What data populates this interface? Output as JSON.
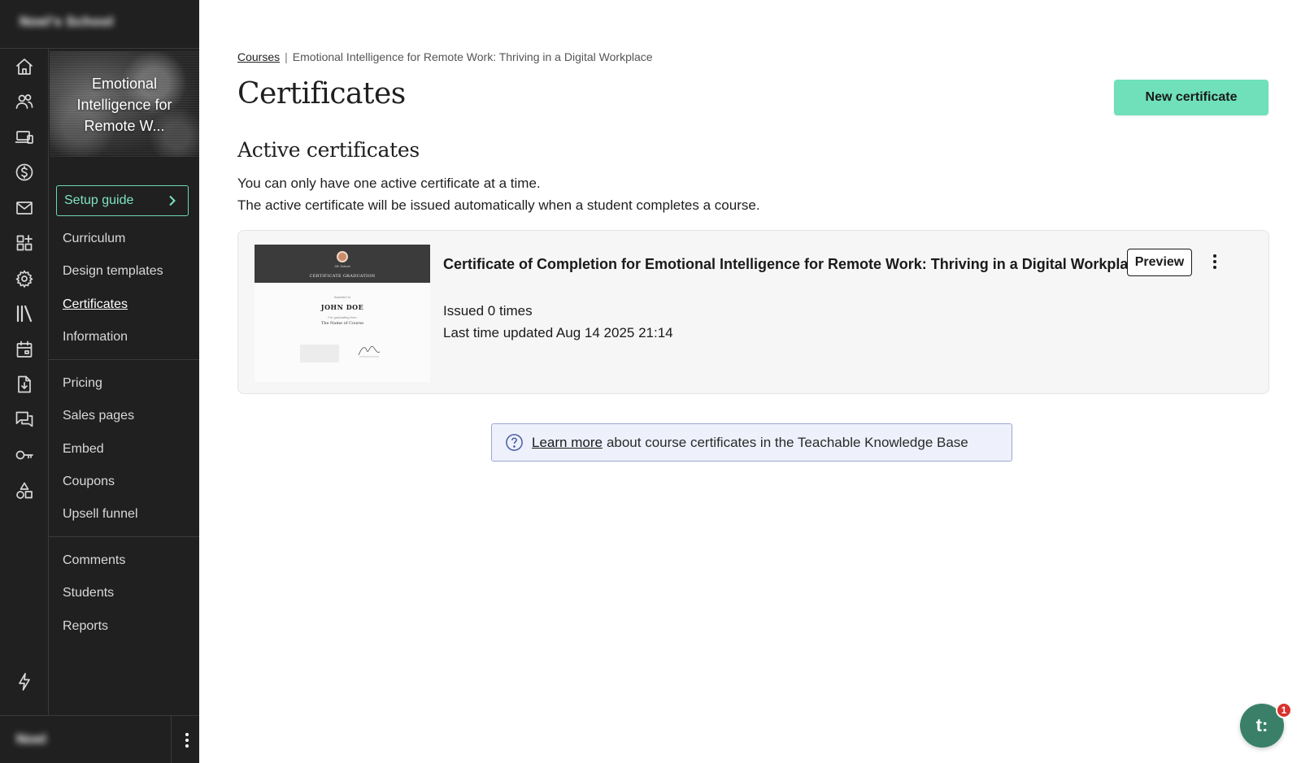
{
  "sidebar": {
    "school_name": "Noel's School",
    "user_name": "Noel",
    "nav_icons": [
      "home-icon",
      "users-icon",
      "devices-icon",
      "dollar-icon",
      "mail-icon",
      "apps-icon",
      "gear-icon",
      "library-icon",
      "calendar-icon",
      "download-icon",
      "chat-icon",
      "key-icon",
      "shapes-icon",
      "lightning-icon"
    ],
    "course": {
      "thumbnail_title": "Emotional Intelligence for Remote W...",
      "setup_guide_label": "Setup guide",
      "groups": [
        [
          "Curriculum",
          "Design templates",
          "Certificates",
          "Information"
        ],
        [
          "Pricing",
          "Sales pages",
          "Embed",
          "Coupons",
          "Upsell funnel"
        ],
        [
          "Comments",
          "Students",
          "Reports"
        ]
      ],
      "active_item": "Certificates"
    }
  },
  "breadcrumb": {
    "root": "Courses",
    "separator": "|",
    "current": "Emotional Intelligence for Remote Work: Thriving in a Digital Workplace"
  },
  "page": {
    "title": "Certificates",
    "new_button": "New certificate",
    "section_title": "Active certificates",
    "desc_line1": "You can only have one active certificate at a time.",
    "desc_line2": "The active certificate will be issued automatically when a student completes a course."
  },
  "certificate": {
    "title": "Certificate of Completion for Emotional Intelligence for Remote Work: Thriving in a Digital Workplace",
    "preview_label": "Preview",
    "issued": "Issued 0 times",
    "updated": "Last time updated Aug 14 2025 21:14",
    "thumb": {
      "school": "OK School",
      "heading": "CERTIFICATE GRADUATION",
      "awarded": "Awarded to",
      "recipient": "JOHN DOE",
      "completing": "For graduating from",
      "course": "The Name of Course"
    }
  },
  "knowledge_base": {
    "link": "Learn more",
    "text": "about course certificates in the Teachable Knowledge Base"
  },
  "chat": {
    "label": "t:",
    "badge": "1"
  },
  "colors": {
    "accent": "#6fe0ba",
    "sidebar_bg": "#202020",
    "setup_border": "#6fd8b4",
    "kb_border": "#9aa7d6",
    "chat": "#3a8068",
    "badge": "#d9312b"
  }
}
